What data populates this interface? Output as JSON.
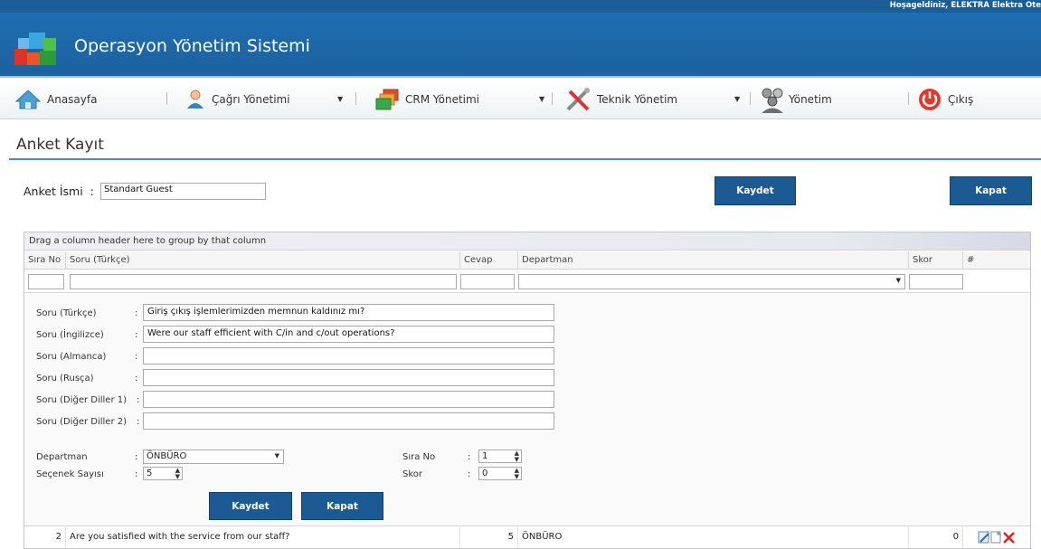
{
  "header": {
    "welcome": "Hoşageldiniz, ELEKTRA Elektra Ote",
    "app_title": "Operasyon Yönetim Sistemi",
    "colors": {
      "brand": "#1f6eb2",
      "button": "#1c5a93"
    }
  },
  "menu": {
    "items": [
      {
        "label": "Anasayfa",
        "icon": "home-icon"
      },
      {
        "label": "Çağrı Yönetimi",
        "icon": "user-icon"
      },
      {
        "label": "CRM Yönetimi",
        "icon": "windows-icon"
      },
      {
        "label": "Teknik Yönetim",
        "icon": "tools-icon"
      },
      {
        "label": "Yönetim",
        "icon": "users-group-icon"
      },
      {
        "label": "Çıkış",
        "icon": "power-icon"
      }
    ]
  },
  "page": {
    "title": "Anket Kayıt",
    "name_label": "Anket İsmi",
    "name_colon": ":",
    "name_value": "Standart Guest",
    "save_label": "Kaydet",
    "close_label": "Kapat"
  },
  "grid": {
    "group_hint": "Drag a column header here to group by that column",
    "columns": [
      "Sıra No",
      "Soru (Türkçe)",
      "Cevap",
      "Departman",
      "Skor",
      "#"
    ],
    "edit_form": {
      "fields": [
        {
          "label": "Soru (Türkçe)",
          "colon": ":",
          "value": "Giriş çıkış işlemlerimizden memnun kaldınız mı?"
        },
        {
          "label": "Soru (İngilizce)",
          "colon": ":",
          "value": "Were our staff efficient with C/in and c/out operations?"
        },
        {
          "label": "Soru (Almanca)",
          "colon": ":",
          "value": ""
        },
        {
          "label": "Soru (Rusça)",
          "colon": ":",
          "value": ""
        },
        {
          "label": "Soru (Diğer Diller 1)",
          "colon": ":",
          "value": ""
        },
        {
          "label": "Soru (Diğer Diller 2)",
          "colon": ":",
          "value": ""
        }
      ],
      "departman_label": "Departman",
      "departman_value": "ÖNBÜRO",
      "secenek_label": "Seçenek Sayısı",
      "secenek_value": "5",
      "sira_label": "Sıra No",
      "sira_value": "1",
      "skor_label": "Skor",
      "skor_value": "0",
      "colon": ":",
      "save_label": "Kaydet",
      "close_label": "Kapat"
    },
    "rows": [
      {
        "sira": "2",
        "soru": "Are you satisfied with the service from our staff?",
        "cevap": "5",
        "departman": "ÖNBÜRO",
        "skor": "0"
      }
    ]
  }
}
